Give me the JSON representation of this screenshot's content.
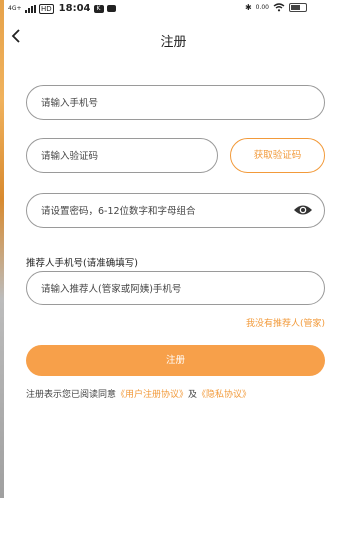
{
  "status_bar": {
    "network": "4G+",
    "time": "18:04",
    "badge": "K",
    "speed": "0.00",
    "battery_level": "0.6"
  },
  "header": {
    "back_icon": "chevron-left-icon",
    "title": "注册"
  },
  "form": {
    "phone_placeholder": "请输入手机号",
    "code_placeholder": "请输入验证码",
    "get_code_label": "获取验证码",
    "password_placeholder": "请设置密码，6-12位数字和字母组合",
    "password_toggle_icon": "eye-icon",
    "referrer_label": "推荐人手机号(请准确填写)",
    "referrer_placeholder": "请输入推荐人(管家或阿姨)手机号",
    "no_referrer_link": "我没有推荐人(管家)",
    "submit_label": "注册"
  },
  "agreement": {
    "prefix": "注册表示您已阅读同意",
    "user_agreement": "《用户注册协议》",
    "and": "及",
    "privacy_policy": "《隐私协议》"
  },
  "colors": {
    "accent": "#f29a3a",
    "button": "#f7a04a",
    "border": "#9a9a9a"
  }
}
